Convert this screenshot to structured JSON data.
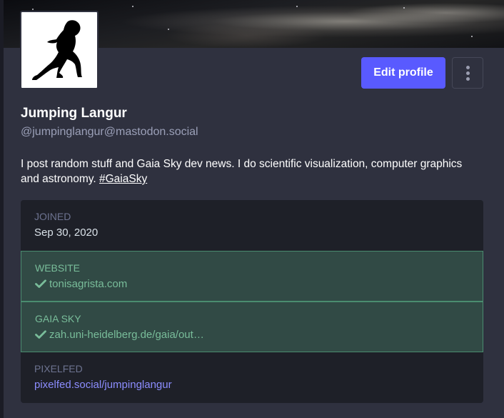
{
  "profile": {
    "display_name": "Jumping Langur",
    "handle": "@jumpinglangur@mastodon.social",
    "bio_text": "I post random stuff and Gaia Sky dev news. I do scientific visualization, computer graphics and astronomy. ",
    "bio_hashtag": "#GaiaSky"
  },
  "actions": {
    "edit_profile_label": "Edit profile"
  },
  "fields": {
    "joined": {
      "name": "JOINED",
      "value": "Sep 30, 2020"
    },
    "website": {
      "name": "WEBSITE",
      "value": "tonisagrista.com",
      "verified": true
    },
    "gaia_sky": {
      "name": "GAIA SKY",
      "value": "zah.uni-heidelberg.de/gaia/out…",
      "verified": true
    },
    "pixelfed": {
      "name": "PIXELFED",
      "value": "pixelfed.social/jumpinglangur"
    }
  },
  "colors": {
    "accent": "#595aff",
    "verified": "#79bd9a",
    "link": "#8c8dff",
    "background": "#2f313f"
  },
  "icons": {
    "avatar": "langur-silhouette",
    "verified": "check-icon",
    "menu": "more-vertical-icon"
  }
}
